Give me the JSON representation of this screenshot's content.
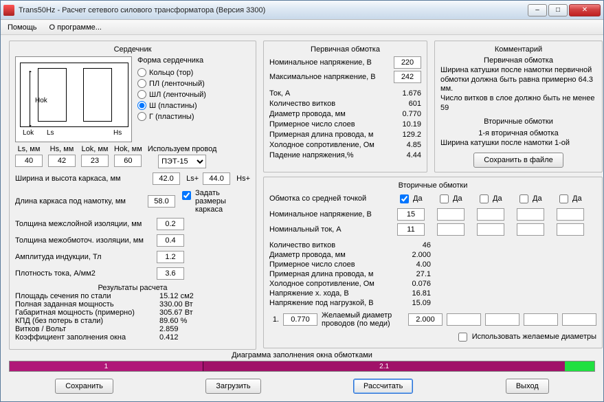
{
  "window": {
    "title": "Trans50Hz - Расчет сетевого силового трансформатора (Версия 3300)"
  },
  "menu": {
    "help": "Помощь",
    "about": "О программе..."
  },
  "core": {
    "title": "Сердечник",
    "shape_label": "Форма сердечника",
    "shapes": {
      "ring": "Кольцо (тор)",
      "pl": "ПЛ (ленточный)",
      "shl": "ШЛ (ленточный)",
      "sh": "Ш (пластины)",
      "g": "Г (пластины)"
    },
    "dims": {
      "ls_label": "Ls, мм",
      "ls": "40",
      "hs_label": "Hs, мм",
      "hs": "42",
      "lok_label": "Lok, мм",
      "lok": "23",
      "hok_label": "Hok, мм",
      "hok": "60"
    },
    "wire_label": "Используем провод",
    "wire_value": "ПЭТ-15",
    "diagram_labels": {
      "hok": "Hok",
      "lok": "Lok",
      "ls": "Ls",
      "hs": "Hs"
    }
  },
  "frame": {
    "wh_label": "Ширина и высота каркаса, мм",
    "w": "42.0",
    "w_suffix": "Ls+",
    "h": "44.0",
    "h_suffix": "Hs+",
    "len_label": "Длина каркаса под намотку, мм",
    "len": "58.0",
    "set_label": "Задать размеры каркаса",
    "interlayer_label": "Толщина межслойной изоляции, мм",
    "interlayer": "0.2",
    "interwind_label": "Толщина межобмоточ. изоляции, мм",
    "interwind": "0.4",
    "bamp_label": "Амплитуда индукции, Тл",
    "bamp": "1.2",
    "jdens_label": "Плотность тока, А/мм2",
    "jdens": "3.6"
  },
  "results": {
    "title": "Результаты расчета",
    "rows": [
      {
        "k": "Площадь сечения по стали",
        "v": "15.12 см2"
      },
      {
        "k": "Полная заданная мощность",
        "v": "330.00 Вт"
      },
      {
        "k": "Габаритная мощность (примерно)",
        "v": "305.67 Вт"
      },
      {
        "k": "КПД (без потерь в стали)",
        "v": "89.60 %"
      },
      {
        "k": "Витков / Вольт",
        "v": "2.859"
      },
      {
        "k": "Коэффициент заполнения окна",
        "v": "0.412"
      }
    ]
  },
  "primary": {
    "title": "Первичная обмотка",
    "vnom_label": "Номинальное напряжение, В",
    "vnom": "220",
    "vmax_label": "Максимальное напряжение, В",
    "vmax": "242",
    "rows": [
      {
        "k": "Ток, А",
        "v": "1.676"
      },
      {
        "k": "Количество витков",
        "v": "601"
      },
      {
        "k": "Диаметр провода, мм",
        "v": "0.770"
      },
      {
        "k": "Примерное число слоев",
        "v": "10.19"
      },
      {
        "k": "Примерная длина провода, м",
        "v": "129.2"
      },
      {
        "k": "Холодное сопротивление, Ом",
        "v": "4.85"
      },
      {
        "k": "Падение напряжения,%",
        "v": "4.44"
      }
    ]
  },
  "comments": {
    "title": "Комментарий",
    "p1_title": "Первичная обмотка",
    "p1_l1": "Ширина катушки после намотки первичной обмотки должна быть равна примерно 64.3 мм.",
    "p1_l2": "Число витков в слое должно быть не менее 59",
    "s_title": "Вторичные обмотки",
    "s_l1": "1-я вторичная обмотка",
    "s_l2": "Ширина катушки после намотки 1-ой",
    "save_btn": "Сохранить в файле"
  },
  "secondary": {
    "title": "Вторичные обмотки",
    "center_label": "Обмотка со средней точкой",
    "da": "Да",
    "vnom_label": "Номинальное напряжение, В",
    "inom_label": "Номинальный ток, А",
    "vnom": [
      "15",
      "",
      "",
      "",
      ""
    ],
    "inom": [
      "11",
      "",
      "",
      "",
      ""
    ],
    "center_checked": [
      true,
      false,
      false,
      false,
      false
    ],
    "rows": [
      {
        "k": "Количество витков",
        "v": "46"
      },
      {
        "k": "Диаметр провода, мм",
        "v": "2.000"
      },
      {
        "k": "Примерное число слоев",
        "v": "4.00"
      },
      {
        "k": "Примерная длина провода, м",
        "v": "27.1"
      },
      {
        "k": "Холодное сопротивление, Ом",
        "v": "0.076"
      },
      {
        "k": "Напряжение х. хода, В",
        "v": "16.81"
      },
      {
        "k": "Напряжение под нагрузкой, В",
        "v": "15.09"
      }
    ],
    "d_num": "1.",
    "d_actual": "0.770",
    "d_label": "Желаемый диаметр проводов (по меди)",
    "d_desired": [
      "2.000",
      "",
      "",
      "",
      ""
    ],
    "use_desired": "Использовать желаемые диаметры"
  },
  "diagram": {
    "title": "Диаграмма заполнения окна обмотками",
    "seg1": "1",
    "seg2": "2.1",
    "w1": 33,
    "w2": 62,
    "w3": 5
  },
  "buttons": {
    "save": "Сохранить",
    "load": "Загрузить",
    "calc": "Рассчитать",
    "exit": "Выход"
  }
}
